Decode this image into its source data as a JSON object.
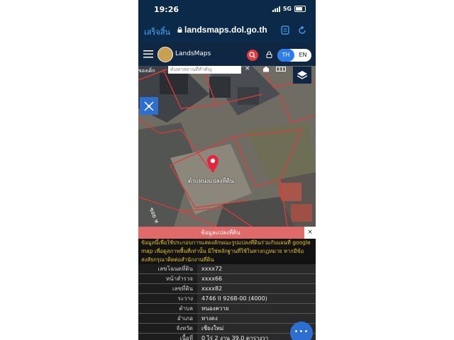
{
  "status_bar": {
    "time": "19:26",
    "network": "5G"
  },
  "browser": {
    "done_label": "เสร็จสิ้น",
    "url": "landsmaps.dol.go.th"
  },
  "app": {
    "title": "LandsMaps",
    "lang_th": "TH",
    "lang_en": "EN"
  },
  "map": {
    "search_placeholder": "ค้นหาสถานที่สำคัญ",
    "pin_label": "ตำแหน่งแปลงที่ดิน",
    "road_label": "ซอย ห",
    "place_label": "ของเด็ก"
  },
  "info": {
    "title": "ข้อมูลแปลงที่ดิน",
    "close": "×",
    "notice": "ข้อมูลนี้เพื่อใช้ประกอบการแสดงลักษณะรูปแปลงที่ดินร่วมกับแผนที่ google map เพื่อดูสภาพพื้นที่เท่านั้น มิใช่หลักฐานที่ใช้ในทางกฎหมาย หากมีข้อสงสัยกรุณาติดต่อสำนักงานที่ดิน",
    "rows": [
      {
        "label": "เลขโฉนดที่ดิน",
        "value": "xxxx72"
      },
      {
        "label": "หน้าสำรวจ",
        "value": "xxxx66"
      },
      {
        "label": "เลขที่ดิน",
        "value": "xxxx82"
      },
      {
        "label": "ระวาง",
        "value": "4746 II 9268-00 (4000)"
      },
      {
        "label": "ตำบล",
        "value": "หนองควาย"
      },
      {
        "label": "อำเภอ",
        "value": "หางดง"
      },
      {
        "label": "จังหวัด",
        "value": "เชียงใหม่"
      },
      {
        "label": "เนื้อที่",
        "value": "0 ไร่ 2 งาน 39.0 ตารางวา"
      }
    ]
  },
  "fab_label": "•••",
  "colors": {
    "header": "#0f2742",
    "accent": "#2b7de9",
    "pin": "#e8233c",
    "notice_text": "#e4c21b",
    "info_header": "#e06a6a"
  }
}
